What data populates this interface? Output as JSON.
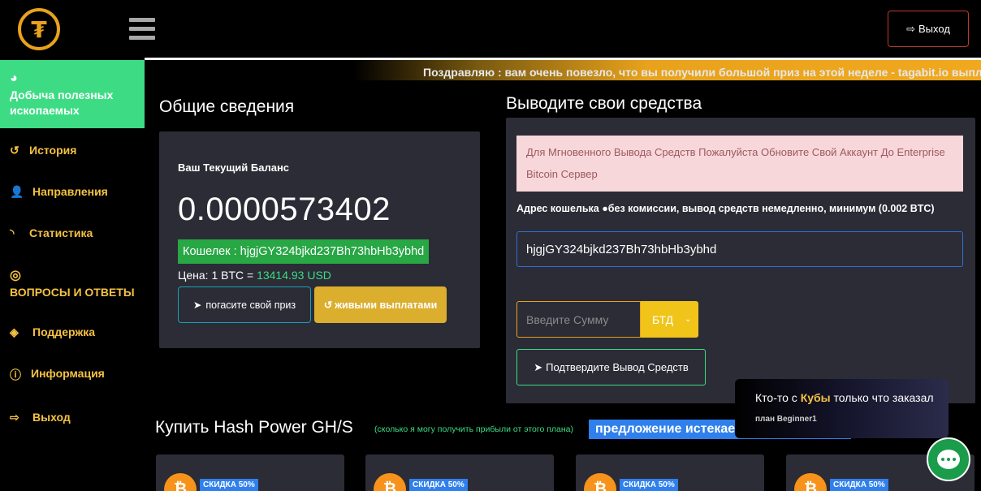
{
  "header": {
    "logo_glyph": "₮",
    "logout_label": "Выход"
  },
  "sidebar": {
    "items": [
      {
        "label": "Добыча полезных ископаемых",
        "icon": "tachometer-icon"
      },
      {
        "label": "История",
        "icon": "history-icon"
      },
      {
        "label": "Направления",
        "icon": "user-plus-icon"
      },
      {
        "label": "Статистика",
        "icon": "rss-icon"
      },
      {
        "label": "ВОПРОСЫ И ОТВЕТЫ",
        "icon": "life-ring-icon"
      },
      {
        "label": "Поддержка",
        "icon": "ticket-icon"
      },
      {
        "label": "Информация",
        "icon": "info-icon"
      },
      {
        "label": "Выход",
        "icon": "sign-out-icon"
      }
    ]
  },
  "ticker": "Поздравляю : вам очень повезло, что вы получили большой приз на этой неделе - tagabit.io выплата на этой",
  "overview": {
    "title": "Общие сведения",
    "balance_label": "Ваш Текущий Баланс",
    "balance_value": "0.0000573402",
    "wallet_badge": "Кошелек : hjgjGY324bjkd237Bh73hbHb3ybhd",
    "price_prefix": "Цена: 1 BTC = ",
    "price_value": "13414.93 USD",
    "prize_button": "погасите свой приз",
    "live_button": "живыми выплатами"
  },
  "withdraw": {
    "title": "Выводите свои средства",
    "alert": "Для Мгновенного Вывода Средств Пожалуйста Обновите Свой Аккаунт До Enterprise Bitcoin Сервер",
    "address_label": "Адрес кошелька",
    "address_note": "без комиссии, вывод средств немедленно, минимум (0.002 BTC)",
    "address_value": "hjgjGY324bjkd237Bh73hbHb3ybhd",
    "amount_placeholder": "Введите Сумму",
    "currency": "БТД",
    "confirm_button": "Подтвердите Вывод Средств"
  },
  "notification": {
    "prefix": "Кто-то с ",
    "country": "Кубы",
    "suffix": " только что заказал",
    "plan": "план Beginner1"
  },
  "hash": {
    "title": "Купить Hash Power GH/S",
    "subtitle": "(сколько я могу получить прибыли от этого плана)",
    "expire_badge": "предложение истекает",
    "plans": [
      {
        "discount": "СКИДКА 50%"
      },
      {
        "discount": "СКИДКА 50%"
      },
      {
        "discount": "СКИДКА 50%"
      },
      {
        "discount": "СКИДКА 50%"
      }
    ]
  }
}
